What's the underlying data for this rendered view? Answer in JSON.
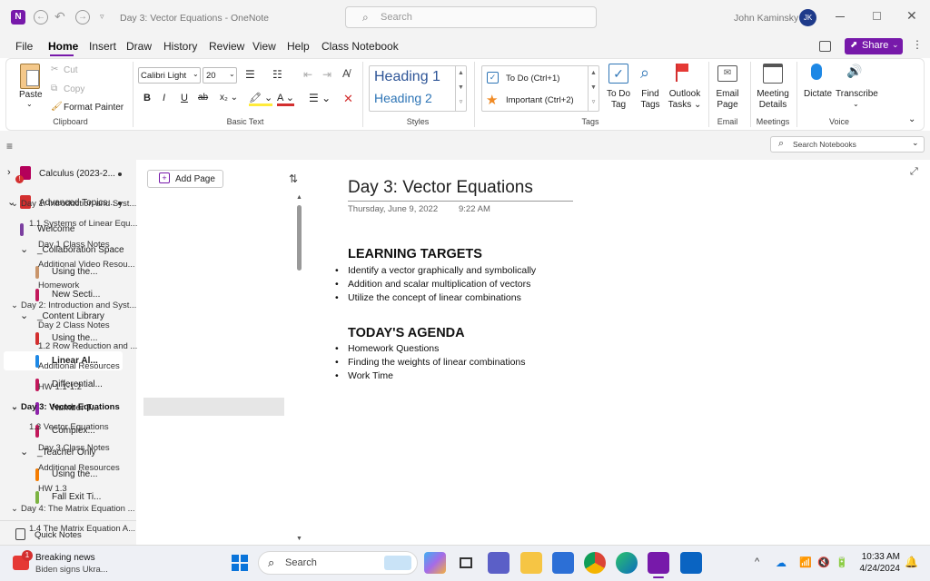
{
  "window": {
    "app_icon": "N",
    "title": "Day 3: Vector Equations  -  OneNote",
    "search_placeholder": "Search",
    "user_name": "John Kaminsky",
    "user_initials": "JK"
  },
  "menu": [
    "File",
    "Home",
    "Insert",
    "Draw",
    "History",
    "Review",
    "View",
    "Help",
    "Class Notebook"
  ],
  "menu_active": "Home",
  "share_label": "Share",
  "ribbon": {
    "clipboard": {
      "paste": "Paste",
      "cut": "Cut",
      "copy": "Copy",
      "format_painter": "Format Painter",
      "group": "Clipboard"
    },
    "basic_text": {
      "font": "Calibri Light",
      "size": "20",
      "group": "Basic Text"
    },
    "styles": {
      "heading1": "Heading 1",
      "heading2": "Heading 2",
      "group": "Styles"
    },
    "tags": {
      "todo": "To Do (Ctrl+1)",
      "important": "Important (Ctrl+2)",
      "group": "Tags",
      "todo_tag": "To Do Tag",
      "todo_tag_l1": "To Do",
      "todo_tag_l2": "Tag",
      "find_tags_l1": "Find",
      "find_tags_l2": "Tags",
      "outlook_l1": "Outlook",
      "outlook_l2": "Tasks ⌄"
    },
    "email": {
      "l1": "Email",
      "l2": "Page",
      "group": "Email"
    },
    "meetings": {
      "l1": "Meeting",
      "l2": "Details",
      "group": "Meetings"
    },
    "voice": {
      "dictate": "Dictate",
      "transcribe": "Transcribe",
      "group": "Voice"
    }
  },
  "search_notebooks": "Search Notebooks",
  "sections": [
    {
      "label": "Calculus (2023-2...",
      "color": "#b4005a",
      "level": 0,
      "chev": "›"
    },
    {
      "label": "Advanced Topics...",
      "color": "#d32f2f",
      "level": 0,
      "chev": "⌄"
    },
    {
      "label": "Welcome",
      "color": "#7b3fa0",
      "level": 1,
      "chev": ""
    },
    {
      "label": "_Collaboration Space",
      "color": "",
      "level": 1,
      "chev": "⌄"
    },
    {
      "label": "Using the...",
      "color": "#c9956b",
      "level": 2,
      "chev": ""
    },
    {
      "label": "New Secti...",
      "color": "#c2185b",
      "level": 2,
      "chev": ""
    },
    {
      "label": "_Content Library",
      "color": "",
      "level": 1,
      "chev": "⌄"
    },
    {
      "label": "Using the...",
      "color": "#d32f2f",
      "level": 2,
      "chev": ""
    },
    {
      "label": "Linear Al...",
      "color": "#1e88e5",
      "level": 2,
      "chev": "",
      "selected": true
    },
    {
      "label": "Differential...",
      "color": "#c2185b",
      "level": 2,
      "chev": ""
    },
    {
      "label": "Number T...",
      "color": "#8e24aa",
      "level": 2,
      "chev": ""
    },
    {
      "label": "Complex...",
      "color": "#c2185b",
      "level": 2,
      "chev": ""
    },
    {
      "label": "_Teacher Only",
      "color": "",
      "level": 1,
      "chev": "⌄"
    },
    {
      "label": "Using the...",
      "color": "#f57c00",
      "level": 2,
      "chev": ""
    },
    {
      "label": "Fall Exit Ti...",
      "color": "#7cb342",
      "level": 2,
      "chev": ""
    }
  ],
  "quick_notes": "Quick Notes",
  "add_page": "Add Page",
  "pages": [
    {
      "label": "Day 1: Introduction and Syst...",
      "level": 0,
      "chev": "⌄"
    },
    {
      "label": "1.1 Systems of Linear Equ...",
      "level": 1
    },
    {
      "label": "Day 1 Class Notes",
      "level": 2
    },
    {
      "label": "Additional Video Resou...",
      "level": 2
    },
    {
      "label": "Homework",
      "level": 2
    },
    {
      "label": "Day 2: Introduction and Syst...",
      "level": 0,
      "chev": "⌄"
    },
    {
      "label": "Day 2 Class Notes",
      "level": 2
    },
    {
      "label": "1.2 Row Reduction and ...",
      "level": 2
    },
    {
      "label": "Additional Resources",
      "level": 2
    },
    {
      "label": "HW 1.1-1.2",
      "level": 2
    },
    {
      "label": "Day 3: Vector Equations",
      "level": 0,
      "chev": "⌄",
      "selected": true
    },
    {
      "label": "1.3 Vector Equations",
      "level": 1
    },
    {
      "label": "Day 3 Class Notes",
      "level": 2
    },
    {
      "label": "Additional Resources",
      "level": 2
    },
    {
      "label": "HW 1.3",
      "level": 2
    },
    {
      "label": "Day 4: The Matrix Equation ...",
      "level": 0,
      "chev": "⌄"
    },
    {
      "label": "1.4 The Matrix Equation A...",
      "level": 1
    }
  ],
  "note": {
    "title": "Day 3: Vector Equations",
    "date": "Thursday, June 9, 2022",
    "time": "9:22 AM",
    "h1": "LEARNING TARGETS",
    "targets": [
      "Identify a vector graphically and symbolically",
      "Addition and scalar multiplication of vectors",
      "Utilize the concept of linear combinations"
    ],
    "h2": "TODAY'S AGENDA",
    "agenda": [
      "Homework Questions",
      "Finding the weights of linear combinations",
      "Work Time"
    ]
  },
  "taskbar": {
    "news_title": "Breaking news",
    "news_sub": "Biden signs Ukra...",
    "news_badge": "1",
    "search": "Search",
    "time": "10:33 AM",
    "date": "4/24/2024"
  }
}
